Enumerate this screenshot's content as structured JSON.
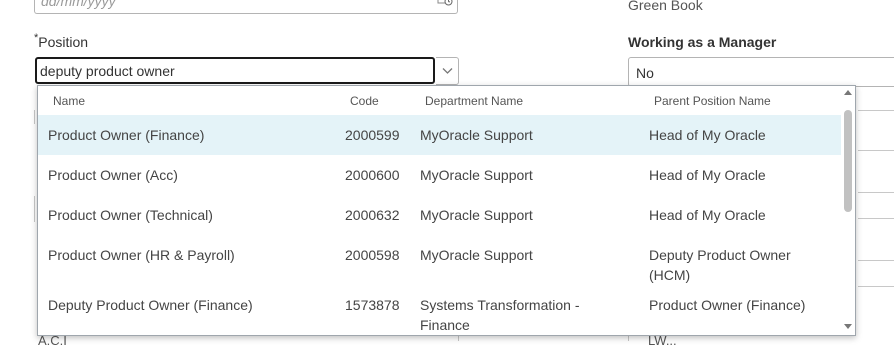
{
  "date_field": {
    "placeholder": "dd/mm/yyyy"
  },
  "green_book": "Green Book",
  "position": {
    "required_marker": "*",
    "label": "Position",
    "value": "deputy product owner"
  },
  "manager": {
    "label": "Working as a Manager",
    "value": "No"
  },
  "popup": {
    "headers": {
      "name": "Name",
      "code": "Code",
      "department": "Department Name",
      "parent": "Parent Position Name"
    },
    "rows": [
      {
        "name": "Product Owner (Finance)",
        "code": "2000599",
        "department": "MyOracle Support",
        "parent": "Head of My Oracle",
        "selected": true
      },
      {
        "name": "Product Owner (Acc)",
        "code": "2000600",
        "department": "MyOracle Support",
        "parent": "Head of My Oracle"
      },
      {
        "name": "Product Owner (Technical)",
        "code": "2000632",
        "department": "MyOracle Support",
        "parent": "Head of My Oracle"
      },
      {
        "name": "Product Owner (HR & Payroll)",
        "code": "2000598",
        "department": "MyOracle Support",
        "parent": "Deputy Product Owner (HCM)"
      },
      {
        "name": "Deputy Product Owner (Finance)",
        "code": "1573878",
        "department": "Systems Transformation - Finance",
        "parent": "Product Owner (Finance)"
      }
    ]
  },
  "background": {
    "bottom_left_fragment": "A.C.I",
    "bottom_right_fragment": "LW..."
  }
}
